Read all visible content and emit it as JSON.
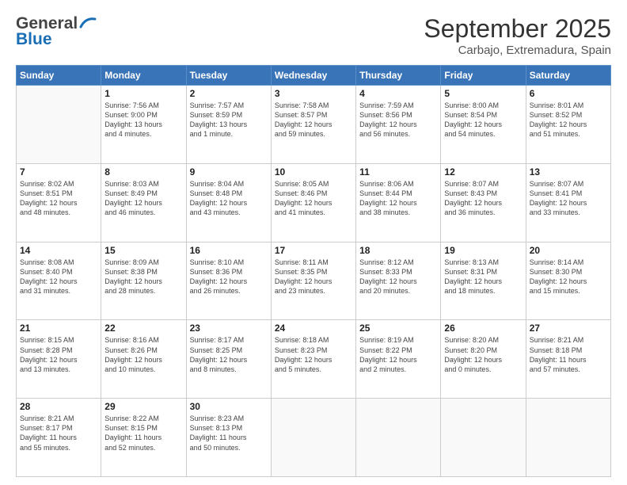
{
  "header": {
    "logo_line1": "General",
    "logo_line2": "Blue",
    "month": "September 2025",
    "location": "Carbajo, Extremadura, Spain"
  },
  "weekdays": [
    "Sunday",
    "Monday",
    "Tuesday",
    "Wednesday",
    "Thursday",
    "Friday",
    "Saturday"
  ],
  "weeks": [
    [
      {
        "day": "",
        "info": ""
      },
      {
        "day": "1",
        "info": "Sunrise: 7:56 AM\nSunset: 9:00 PM\nDaylight: 13 hours\nand 4 minutes."
      },
      {
        "day": "2",
        "info": "Sunrise: 7:57 AM\nSunset: 8:59 PM\nDaylight: 13 hours\nand 1 minute."
      },
      {
        "day": "3",
        "info": "Sunrise: 7:58 AM\nSunset: 8:57 PM\nDaylight: 12 hours\nand 59 minutes."
      },
      {
        "day": "4",
        "info": "Sunrise: 7:59 AM\nSunset: 8:56 PM\nDaylight: 12 hours\nand 56 minutes."
      },
      {
        "day": "5",
        "info": "Sunrise: 8:00 AM\nSunset: 8:54 PM\nDaylight: 12 hours\nand 54 minutes."
      },
      {
        "day": "6",
        "info": "Sunrise: 8:01 AM\nSunset: 8:52 PM\nDaylight: 12 hours\nand 51 minutes."
      }
    ],
    [
      {
        "day": "7",
        "info": "Sunrise: 8:02 AM\nSunset: 8:51 PM\nDaylight: 12 hours\nand 48 minutes."
      },
      {
        "day": "8",
        "info": "Sunrise: 8:03 AM\nSunset: 8:49 PM\nDaylight: 12 hours\nand 46 minutes."
      },
      {
        "day": "9",
        "info": "Sunrise: 8:04 AM\nSunset: 8:48 PM\nDaylight: 12 hours\nand 43 minutes."
      },
      {
        "day": "10",
        "info": "Sunrise: 8:05 AM\nSunset: 8:46 PM\nDaylight: 12 hours\nand 41 minutes."
      },
      {
        "day": "11",
        "info": "Sunrise: 8:06 AM\nSunset: 8:44 PM\nDaylight: 12 hours\nand 38 minutes."
      },
      {
        "day": "12",
        "info": "Sunrise: 8:07 AM\nSunset: 8:43 PM\nDaylight: 12 hours\nand 36 minutes."
      },
      {
        "day": "13",
        "info": "Sunrise: 8:07 AM\nSunset: 8:41 PM\nDaylight: 12 hours\nand 33 minutes."
      }
    ],
    [
      {
        "day": "14",
        "info": "Sunrise: 8:08 AM\nSunset: 8:40 PM\nDaylight: 12 hours\nand 31 minutes."
      },
      {
        "day": "15",
        "info": "Sunrise: 8:09 AM\nSunset: 8:38 PM\nDaylight: 12 hours\nand 28 minutes."
      },
      {
        "day": "16",
        "info": "Sunrise: 8:10 AM\nSunset: 8:36 PM\nDaylight: 12 hours\nand 26 minutes."
      },
      {
        "day": "17",
        "info": "Sunrise: 8:11 AM\nSunset: 8:35 PM\nDaylight: 12 hours\nand 23 minutes."
      },
      {
        "day": "18",
        "info": "Sunrise: 8:12 AM\nSunset: 8:33 PM\nDaylight: 12 hours\nand 20 minutes."
      },
      {
        "day": "19",
        "info": "Sunrise: 8:13 AM\nSunset: 8:31 PM\nDaylight: 12 hours\nand 18 minutes."
      },
      {
        "day": "20",
        "info": "Sunrise: 8:14 AM\nSunset: 8:30 PM\nDaylight: 12 hours\nand 15 minutes."
      }
    ],
    [
      {
        "day": "21",
        "info": "Sunrise: 8:15 AM\nSunset: 8:28 PM\nDaylight: 12 hours\nand 13 minutes."
      },
      {
        "day": "22",
        "info": "Sunrise: 8:16 AM\nSunset: 8:26 PM\nDaylight: 12 hours\nand 10 minutes."
      },
      {
        "day": "23",
        "info": "Sunrise: 8:17 AM\nSunset: 8:25 PM\nDaylight: 12 hours\nand 8 minutes."
      },
      {
        "day": "24",
        "info": "Sunrise: 8:18 AM\nSunset: 8:23 PM\nDaylight: 12 hours\nand 5 minutes."
      },
      {
        "day": "25",
        "info": "Sunrise: 8:19 AM\nSunset: 8:22 PM\nDaylight: 12 hours\nand 2 minutes."
      },
      {
        "day": "26",
        "info": "Sunrise: 8:20 AM\nSunset: 8:20 PM\nDaylight: 12 hours\nand 0 minutes."
      },
      {
        "day": "27",
        "info": "Sunrise: 8:21 AM\nSunset: 8:18 PM\nDaylight: 11 hours\nand 57 minutes."
      }
    ],
    [
      {
        "day": "28",
        "info": "Sunrise: 8:21 AM\nSunset: 8:17 PM\nDaylight: 11 hours\nand 55 minutes."
      },
      {
        "day": "29",
        "info": "Sunrise: 8:22 AM\nSunset: 8:15 PM\nDaylight: 11 hours\nand 52 minutes."
      },
      {
        "day": "30",
        "info": "Sunrise: 8:23 AM\nSunset: 8:13 PM\nDaylight: 11 hours\nand 50 minutes."
      },
      {
        "day": "",
        "info": ""
      },
      {
        "day": "",
        "info": ""
      },
      {
        "day": "",
        "info": ""
      },
      {
        "day": "",
        "info": ""
      }
    ]
  ]
}
